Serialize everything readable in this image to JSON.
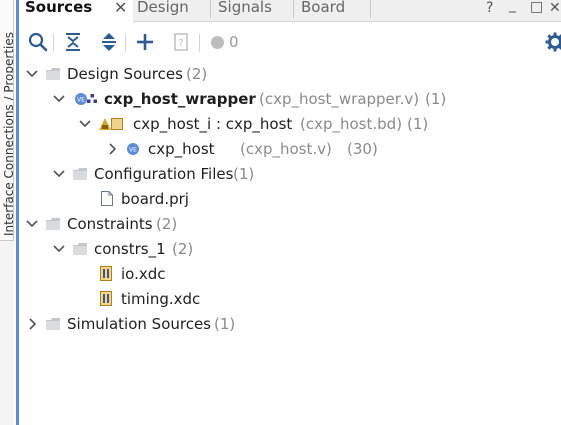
{
  "side_tab": {
    "label": "Interface Connections / Properties"
  },
  "tabs": [
    {
      "label": "Sources"
    },
    {
      "label": "Design"
    },
    {
      "label": "Signals"
    },
    {
      "label": "Board"
    }
  ],
  "window_controls": {
    "help": "?",
    "minimize": "_",
    "maximize": "□",
    "close": "✕"
  },
  "toolbar": {
    "status_count": "0"
  },
  "tree": {
    "design_sources": {
      "label": "Design Sources",
      "count": "(2)"
    },
    "wrapper": {
      "label": "cxp_host_wrapper",
      "file": "(cxp_host_wrapper.v)",
      "count": "(1)"
    },
    "host_i": {
      "label": "cxp_host_i : cxp_host",
      "file": "(cxp_host.bd)",
      "count": "(1)"
    },
    "host": {
      "label": "cxp_host",
      "file": "(cxp_host.v)",
      "count": "(30)"
    },
    "config_files": {
      "label": "Configuration Files",
      "count": "(1)"
    },
    "board": {
      "label": "board.prj"
    },
    "constraints": {
      "label": "Constraints",
      "count": "(2)"
    },
    "constrs_1": {
      "label": "constrs_1",
      "count": "(2)"
    },
    "io": {
      "label": "io.xdc"
    },
    "timing": {
      "label": "timing.xdc"
    },
    "sim_sources": {
      "label": "Simulation Sources",
      "count": "(1)"
    }
  },
  "colors": {
    "accent": "#5b8bd6",
    "folder": "#b9bdc3",
    "verilog_badge": "#5b8bd6",
    "constraint_icon": "#d8a635"
  }
}
